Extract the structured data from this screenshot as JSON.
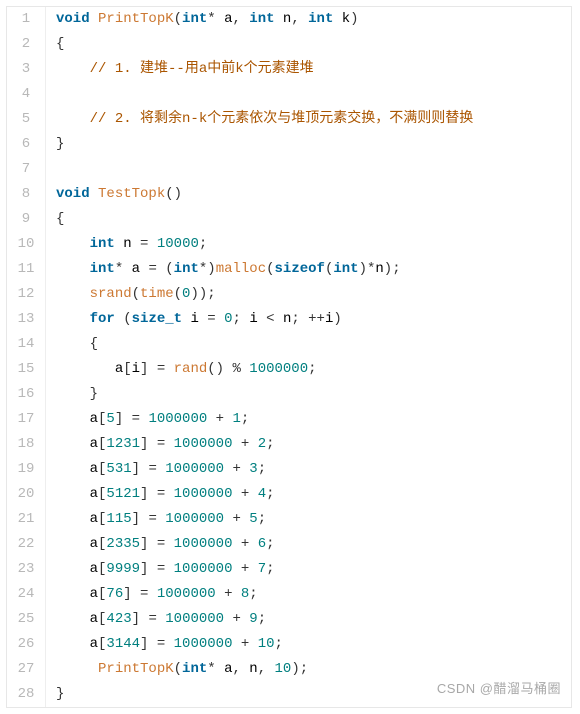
{
  "watermark": "CSDN @醋溜马桶圈",
  "lines": {
    "l1": {
      "n": "1",
      "kw1": "void",
      "fn": "PrintTopK",
      "p1": "(",
      "kw2": "int",
      "star": "*",
      "a": " a",
      "c1": ", ",
      "kw3": "int",
      "nv": " n",
      "c2": ", ",
      "kw4": "int",
      "kv": " k",
      "p2": ")"
    },
    "l2": {
      "n": "2",
      "t": "{"
    },
    "l3": {
      "n": "3",
      "indent": "    ",
      "cmt": "// 1. 建堆--用a中前k个元素建堆"
    },
    "l4": {
      "n": "4",
      "t": ""
    },
    "l5": {
      "n": "5",
      "indent": "    ",
      "cmt": "// 2. 将剩余n-k个元素依次与堆顶元素交换，不满则则替换"
    },
    "l6": {
      "n": "6",
      "t": "}"
    },
    "l7": {
      "n": "7",
      "t": ""
    },
    "l8": {
      "n": "8",
      "kw1": "void",
      "fn": "TestTopk",
      "p1": "(",
      "p2": ")"
    },
    "l9": {
      "n": "9",
      "t": "{"
    },
    "l10": {
      "n": "10",
      "indent": "    ",
      "kw": "int",
      "sp": " ",
      "id": "n",
      "eq": " = ",
      "num": "10000",
      "semi": ";"
    },
    "l11": {
      "n": "11",
      "indent": "    ",
      "kw1": "int",
      "star1": "*",
      "sp1": " ",
      "id1": "a",
      "eq": " = ",
      "p1": "(",
      "kw2": "int",
      "star2": "*",
      "p2": ")",
      "fn": "malloc",
      "p3": "(",
      "kw3": "sizeof",
      "p4": "(",
      "kw4": "int",
      "p5": ")",
      "star3": "*",
      "id2": "n",
      "p6": ")",
      "semi": ";"
    },
    "l12": {
      "n": "12",
      "indent": "    ",
      "fn1": "srand",
      "p1": "(",
      "fn2": "time",
      "p2": "(",
      "num": "0",
      "p3": ")",
      "p4": ")",
      "semi": ";"
    },
    "l13": {
      "n": "13",
      "indent": "    ",
      "kw1": "for",
      "sp1": " ",
      "p1": "(",
      "kw2": "size_t",
      "sp2": " ",
      "id1": "i",
      "eq": " = ",
      "num1": "0",
      "semi1": "; ",
      "id2": "i",
      "lt": " < ",
      "id3": "n",
      "semi2": "; ",
      "inc": "++",
      "id4": "i",
      "p2": ")"
    },
    "l14": {
      "n": "14",
      "indent": "    ",
      "t": "{"
    },
    "l15": {
      "n": "15",
      "indent": "       ",
      "id1": "a",
      "p1": "[",
      "id2": "i",
      "p2": "]",
      "eq": " = ",
      "fn": "rand",
      "p3": "(",
      "p4": ")",
      "mod": " % ",
      "num": "1000000",
      "semi": ";"
    },
    "l16": {
      "n": "16",
      "indent": "    ",
      "t": "}"
    },
    "l17": {
      "n": "17",
      "indent": "    ",
      "id": "a",
      "p1": "[",
      "idx": "5",
      "p2": "]",
      "eq": " = ",
      "num1": "1000000",
      "plus": " + ",
      "num2": "1",
      "semi": ";"
    },
    "l18": {
      "n": "18",
      "indent": "    ",
      "id": "a",
      "p1": "[",
      "idx": "1231",
      "p2": "]",
      "eq": " = ",
      "num1": "1000000",
      "plus": " + ",
      "num2": "2",
      "semi": ";"
    },
    "l19": {
      "n": "19",
      "indent": "    ",
      "id": "a",
      "p1": "[",
      "idx": "531",
      "p2": "]",
      "eq": " = ",
      "num1": "1000000",
      "plus": " + ",
      "num2": "3",
      "semi": ";"
    },
    "l20": {
      "n": "20",
      "indent": "    ",
      "id": "a",
      "p1": "[",
      "idx": "5121",
      "p2": "]",
      "eq": " = ",
      "num1": "1000000",
      "plus": " + ",
      "num2": "4",
      "semi": ";"
    },
    "l21": {
      "n": "21",
      "indent": "    ",
      "id": "a",
      "p1": "[",
      "idx": "115",
      "p2": "]",
      "eq": " = ",
      "num1": "1000000",
      "plus": " + ",
      "num2": "5",
      "semi": ";"
    },
    "l22": {
      "n": "22",
      "indent": "    ",
      "id": "a",
      "p1": "[",
      "idx": "2335",
      "p2": "]",
      "eq": " = ",
      "num1": "1000000",
      "plus": " + ",
      "num2": "6",
      "semi": ";"
    },
    "l23": {
      "n": "23",
      "indent": "    ",
      "id": "a",
      "p1": "[",
      "idx": "9999",
      "p2": "]",
      "eq": " = ",
      "num1": "1000000",
      "plus": " + ",
      "num2": "7",
      "semi": ";"
    },
    "l24": {
      "n": "24",
      "indent": "    ",
      "id": "a",
      "p1": "[",
      "idx": "76",
      "p2": "]",
      "eq": " = ",
      "num1": "1000000",
      "plus": " + ",
      "num2": "8",
      "semi": ";"
    },
    "l25": {
      "n": "25",
      "indent": "    ",
      "id": "a",
      "p1": "[",
      "idx": "423",
      "p2": "]",
      "eq": " = ",
      "num1": "1000000",
      "plus": " + ",
      "num2": "9",
      "semi": ";"
    },
    "l26": {
      "n": "26",
      "indent": "    ",
      "id": "a",
      "p1": "[",
      "idx": "3144",
      "p2": "]",
      "eq": " = ",
      "num1": "1000000",
      "plus": " + ",
      "num2": "10",
      "semi": ";"
    },
    "l27": {
      "n": "27",
      "indent": "     ",
      "fn": "PrintTopK",
      "p1": "(",
      "kw": "int",
      "star": "*",
      "sp": " ",
      "id1": "a",
      "c1": ", ",
      "id2": "n",
      "c2": ", ",
      "num": "10",
      "p2": ")",
      "semi": ";"
    },
    "l28": {
      "n": "28",
      "t": "}"
    }
  }
}
